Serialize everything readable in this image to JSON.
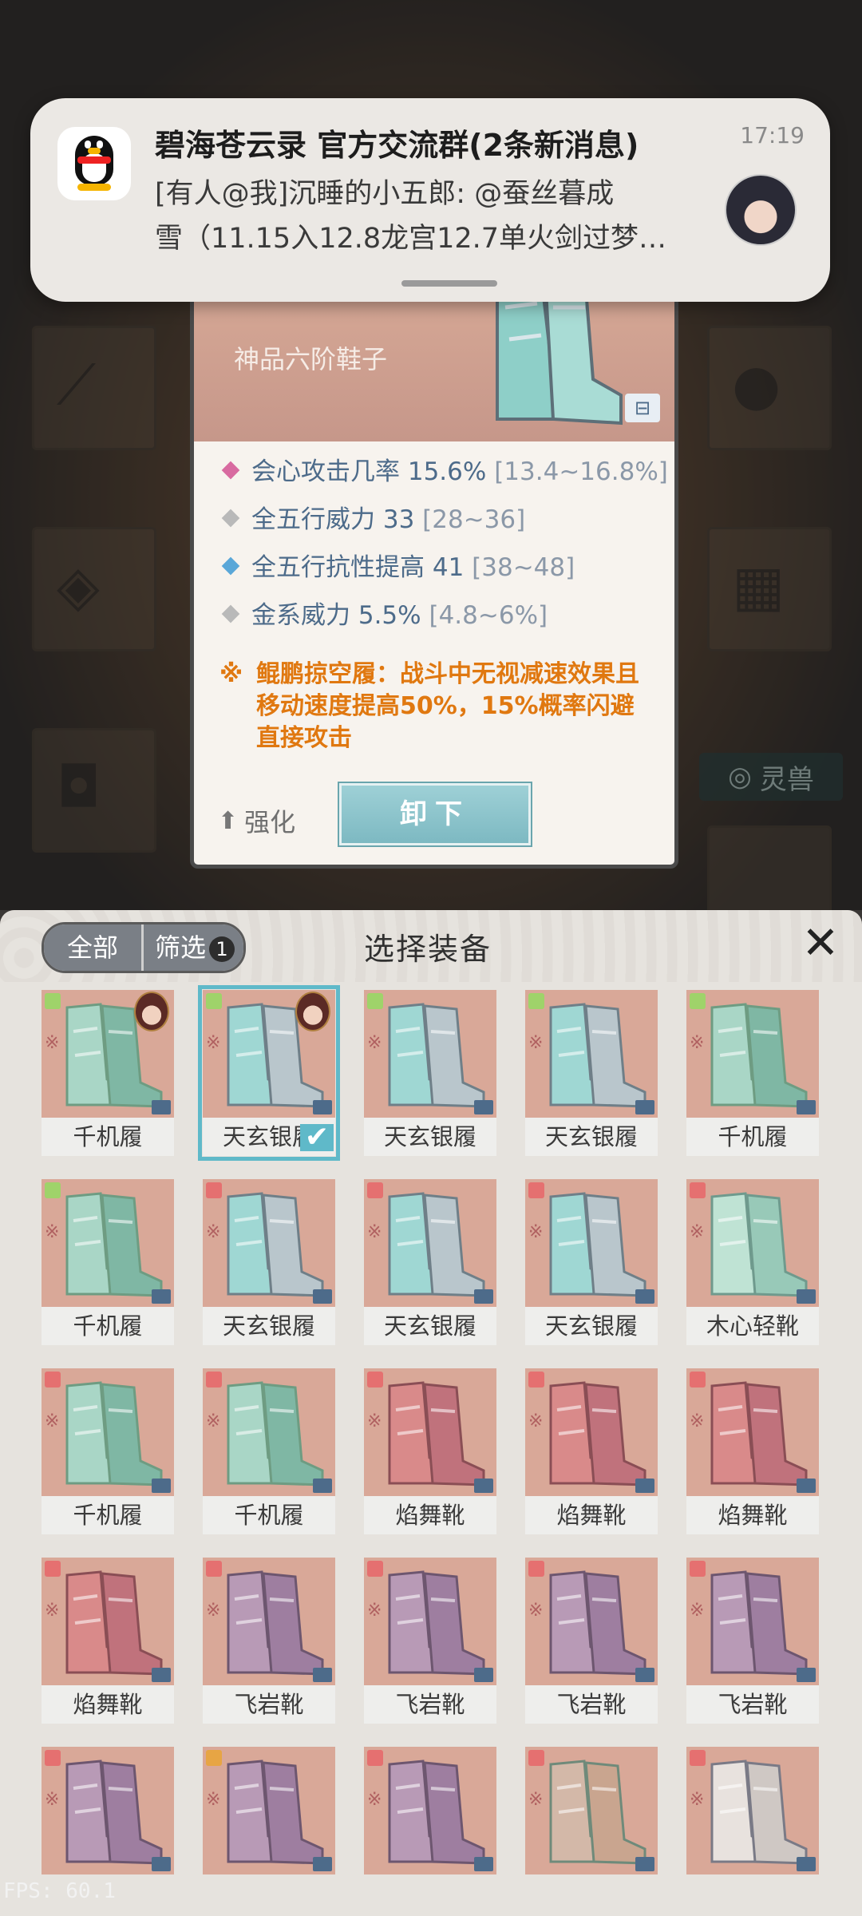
{
  "notification": {
    "title": "碧海苍云录 官方交流群(2条新消息)",
    "time": "17:19",
    "line1": "[有人@我]沉睡的小五郎: @蚕丝暮成",
    "line2": "雪（11.15入12.8龙宫12.7单火剑过梦…"
  },
  "detail": {
    "subtitle": "神品六阶鞋子",
    "stats": [
      {
        "label": "会心攻击几率 15.6%",
        "range": "[13.4~16.8%]",
        "color": "#d86aa0"
      },
      {
        "label": "全五行威力 33",
        "range": "[28~36]",
        "color": "#b9b9b9"
      },
      {
        "label": "全五行抗性提高 41",
        "range": "[38~48]",
        "color": "#5aa7d8"
      },
      {
        "label": "金系威力 5.5%",
        "range": "[4.8~6%]",
        "color": "#b9b9b9"
      }
    ],
    "special": "鲲鹏掠空履：战斗中无视减速效果且移动速度提高50%，15%概率闪避直接攻击",
    "strengthen": "强化",
    "unequip": "卸下"
  },
  "background": {
    "spirit_label": "灵兽"
  },
  "panel": {
    "tab_all": "全部",
    "tab_filter": "筛选",
    "filter_count": "1",
    "title": "选择装备",
    "items": [
      {
        "name": "千机履",
        "tone": "green",
        "tag": "#9fd36a",
        "hero": true
      },
      {
        "name": "天玄银履",
        "tone": "teal",
        "tag": "#9fd36a",
        "hero": true,
        "selected": true
      },
      {
        "name": "天玄银履",
        "tone": "teal",
        "tag": "#9fd36a"
      },
      {
        "name": "天玄银履",
        "tone": "teal",
        "tag": "#9fd36a"
      },
      {
        "name": "千机履",
        "tone": "green",
        "tag": "#9fd36a"
      },
      {
        "name": "千机履",
        "tone": "green",
        "tag": "#9fd36a"
      },
      {
        "name": "天玄银履",
        "tone": "teal",
        "tag": "#e57070"
      },
      {
        "name": "天玄银履",
        "tone": "teal",
        "tag": "#e57070"
      },
      {
        "name": "天玄银履",
        "tone": "teal",
        "tag": "#e57070"
      },
      {
        "name": "木心轻靴",
        "tone": "mint",
        "tag": "#e57070"
      },
      {
        "name": "千机履",
        "tone": "green",
        "tag": "#e57070"
      },
      {
        "name": "千机履",
        "tone": "green",
        "tag": "#e57070"
      },
      {
        "name": "焰舞靴",
        "tone": "pink",
        "tag": "#e57070"
      },
      {
        "name": "焰舞靴",
        "tone": "pink",
        "tag": "#e57070"
      },
      {
        "name": "焰舞靴",
        "tone": "pink",
        "tag": "#e57070"
      },
      {
        "name": "焰舞靴",
        "tone": "pink",
        "tag": "#e57070"
      },
      {
        "name": "飞岩靴",
        "tone": "purple",
        "tag": "#e57070"
      },
      {
        "name": "飞岩靴",
        "tone": "purple",
        "tag": "#e57070"
      },
      {
        "name": "飞岩靴",
        "tone": "purple",
        "tag": "#e57070"
      },
      {
        "name": "飞岩靴",
        "tone": "purple",
        "tag": "#e57070"
      },
      {
        "name": "",
        "tone": "purple",
        "tag": "#e57070"
      },
      {
        "name": "",
        "tone": "purple",
        "tag": "#e7a544"
      },
      {
        "name": "",
        "tone": "purple",
        "tag": "#e57070"
      },
      {
        "name": "",
        "tone": "wire",
        "tag": "#e57070"
      },
      {
        "name": "",
        "tone": "silver",
        "tag": "#e57070"
      }
    ]
  },
  "fps": "FPS: 60.1"
}
